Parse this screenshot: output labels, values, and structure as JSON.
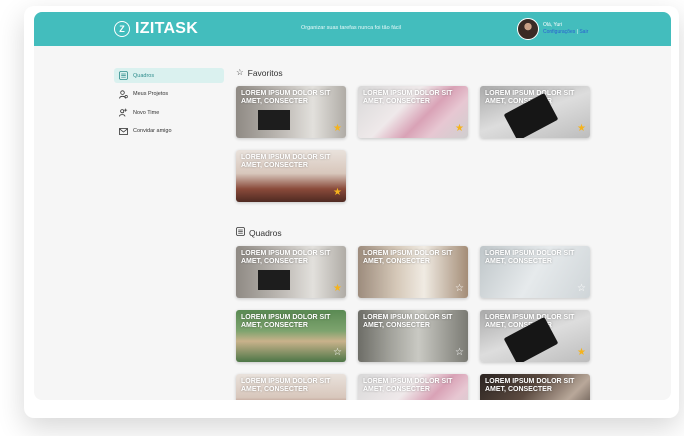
{
  "app": {
    "logo_mark": "Z",
    "name": "IZITASK",
    "tagline": "Organizar suas tarefas nunca foi tão fácil"
  },
  "user": {
    "greeting": "Olá, Yuri",
    "settings_label": "Configurações",
    "separator": "|",
    "logout_label": "Sair"
  },
  "sidebar": {
    "items": [
      {
        "label": "Quadros",
        "icon": "board-icon"
      },
      {
        "label": "Meus Projetos",
        "icon": "users-icon"
      },
      {
        "label": "Novo Time",
        "icon": "add-team-icon"
      },
      {
        "label": "Convidar amigo",
        "icon": "mail-icon"
      }
    ]
  },
  "favorites": {
    "title": "Favoritos",
    "cards": [
      {
        "text": "LOREM IPSUM DOLOR SIT AMET, CONSECTER",
        "favorite": true
      },
      {
        "text": "LOREM IPSUM DOLOR SIT AMET, CONSECTER",
        "favorite": true
      },
      {
        "text": "LOREM IPSUM DOLOR SIT AMET, CONSECTER",
        "favorite": true
      },
      {
        "text": "LOREM IPSUM DOLOR SIT AMET, CONSECTER",
        "favorite": true
      }
    ]
  },
  "boards": {
    "title": "Quadros",
    "cards": [
      {
        "text": "LOREM IPSUM DOLOR SIT AMET, CONSECTER",
        "favorite": true
      },
      {
        "text": "LOREM IPSUM DOLOR SIT AMET, CONSECTER",
        "favorite": false
      },
      {
        "text": "LOREM IPSUM DOLOR SIT AMET, CONSECTER",
        "favorite": false
      },
      {
        "text": "LOREM IPSUM DOLOR SIT AMET, CONSECTER",
        "favorite": false
      },
      {
        "text": "LOREM IPSUM DOLOR SIT AMET, CONSECTER",
        "favorite": false
      },
      {
        "text": "LOREM IPSUM DOLOR SIT AMET, CONSECTER",
        "favorite": true
      },
      {
        "text": "LOREM IPSUM DOLOR SIT AMET, CONSECTER",
        "favorite": false
      },
      {
        "text": "LOREM IPSUM DOLOR SIT AMET, CONSECTER",
        "favorite": false
      },
      {
        "text": "LOREM IPSUM DOLOR SIT AMET, CONSECTER",
        "favorite": false
      }
    ]
  },
  "colors": {
    "header": "#43bdbd",
    "accent_active_bg": "#daf1ef",
    "star_on": "#f5b31c",
    "star_off": "#ffffff"
  }
}
